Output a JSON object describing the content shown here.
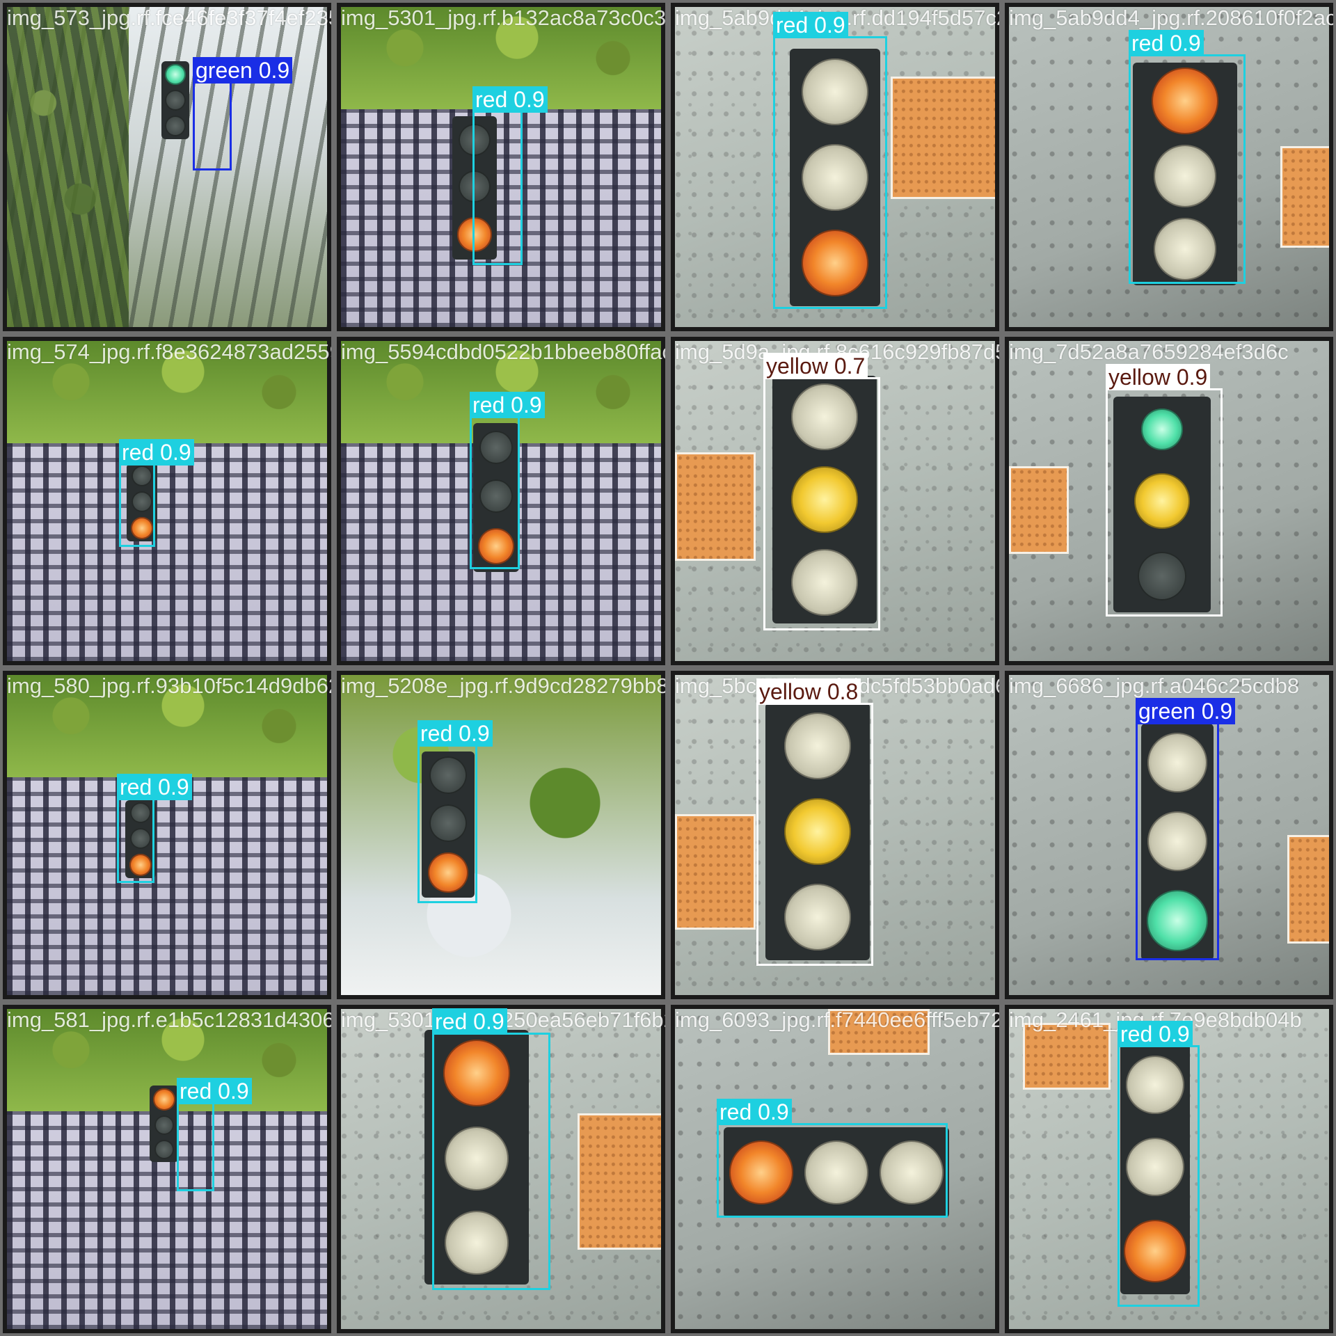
{
  "tiles": [
    {
      "filename": "img_573_jpg.rf.fce46fe3f37f4ef23591aj19b4",
      "label": "green 0.9",
      "cls": "green"
    },
    {
      "filename": "img_5301_jpg.rf.b132ac8a73c0c35a8fc9dd194f5d57c2",
      "label": "red 0.9",
      "cls": "red"
    },
    {
      "filename": "img_5ab9dd4_jpg.rf.dd194f5d57c208610f",
      "label": "red 0.9",
      "cls": "red"
    },
    {
      "filename": "img_5ab9dd4_jpg.rf.208610f0f2acb35ebba1c2",
      "label": "red 0.9",
      "cls": "red"
    },
    {
      "filename": "img_574_jpg.rf.f8e3624873ad25594c0bd0522b1bbeeb8",
      "label": "red 0.9",
      "cls": "red"
    },
    {
      "filename": "img_5594cdbd0522b1bbeeb80ffac0",
      "label": "red 0.9",
      "cls": "red"
    },
    {
      "filename": "img_5d9a_jpg.rf.8c616c929fb87d52a6a9769",
      "label": "yellow 0.7",
      "cls": "yellow"
    },
    {
      "filename": "img_7d52a8a7659284ef3d6c",
      "label": "yellow 0.9",
      "cls": "yellow"
    },
    {
      "filename": "img_580_jpg.rf.93b10f5c14d9db62f9ecd9d9cd28279bb8",
      "label": "red 0.9",
      "cls": "red"
    },
    {
      "filename": "img_5208e_jpg.rf.9d9cd28279bb82bc",
      "label": "red 0.9",
      "cls": "red"
    },
    {
      "filename": "img_5bc62_jpg.rf.ddc5fd53bb0ad6680",
      "label": "yellow 0.8",
      "cls": "yellow"
    },
    {
      "filename": "img_6686_jpg.rf.a046c25cdb8",
      "label": "green 0.9",
      "cls": "green"
    },
    {
      "filename": "img_581_jpg.rf.e1b5c12831d430601",
      "label": "red 0.9",
      "cls": "red"
    },
    {
      "filename": "img_5301_jpg.rf.250ea56eb71f6b2093",
      "label": "red 0.9",
      "cls": "red"
    },
    {
      "filename": "img_6093_jpg.rf.f7440ee6fff5eb724",
      "label": "red 0.9",
      "cls": "red"
    },
    {
      "filename": "img_2461_jpg.rf.7e9e8bdb04b",
      "label": "red 0.9",
      "cls": "red"
    }
  ],
  "colors": {
    "red": "#1ed0e0",
    "green": "#1a2ee6",
    "yellow": "#ffffff",
    "tile_border": "#6e6e6e",
    "background": "#7f7f7f"
  }
}
